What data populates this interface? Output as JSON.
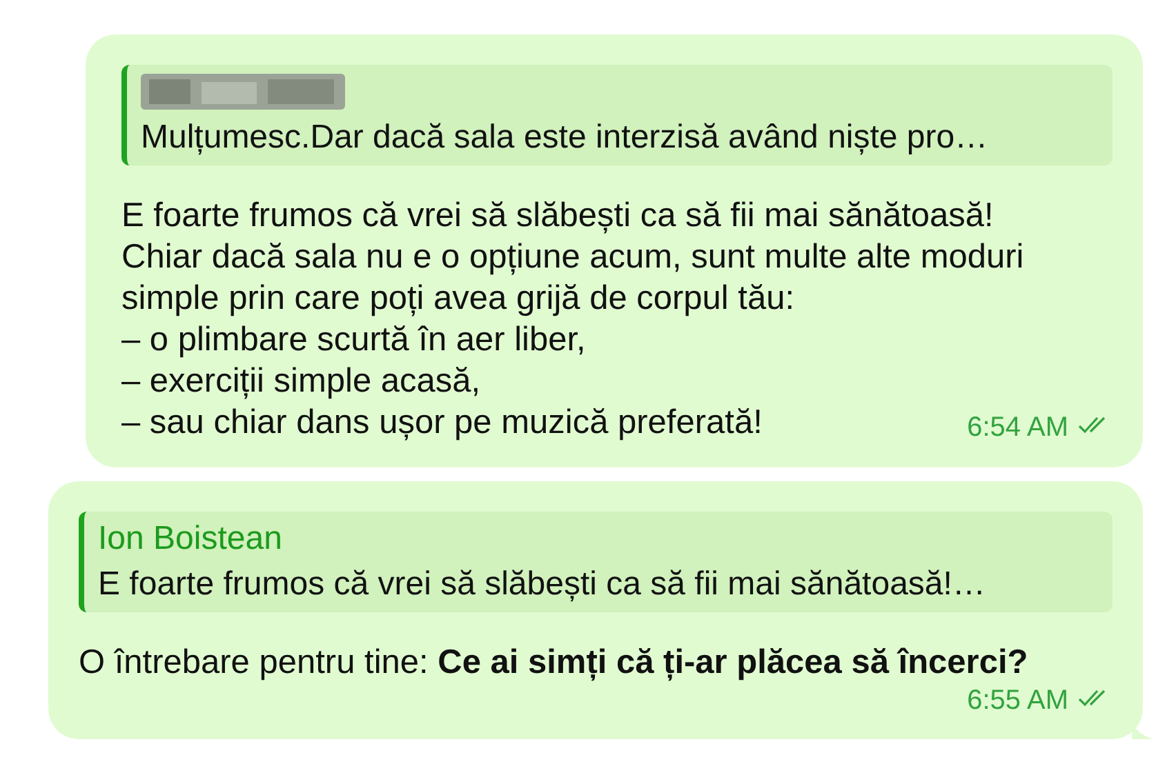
{
  "messages": [
    {
      "reply": {
        "sender_redacted": true,
        "text": "Mulțumesc.Dar  dacă sala este interzisă având niște pro…"
      },
      "lines": [
        "E foarte frumos că vrei să slăbești ca să fii mai sănătoasă!",
        "Chiar dacă sala nu e o opțiune acum, sunt multe alte moduri",
        "simple prin care poți avea grijă de corpul tău:",
        "– o plimbare scurtă în aer liber,",
        "– exerciții simple acasă,",
        "– sau chiar dans ușor pe muzică preferată!"
      ],
      "time": "6:54 AM",
      "read": true,
      "tail": false
    },
    {
      "reply": {
        "sender_redacted": false,
        "sender": "Ion Boistean",
        "text": "E foarte frumos că vrei să slăbești ca să fii mai sănătoasă!…"
      },
      "lines": [
        "O întrebare pentru tine: **Ce ai simți că ți-ar plăcea să încerci?**"
      ],
      "time": "6:55 AM",
      "read": true,
      "tail": true
    }
  ]
}
